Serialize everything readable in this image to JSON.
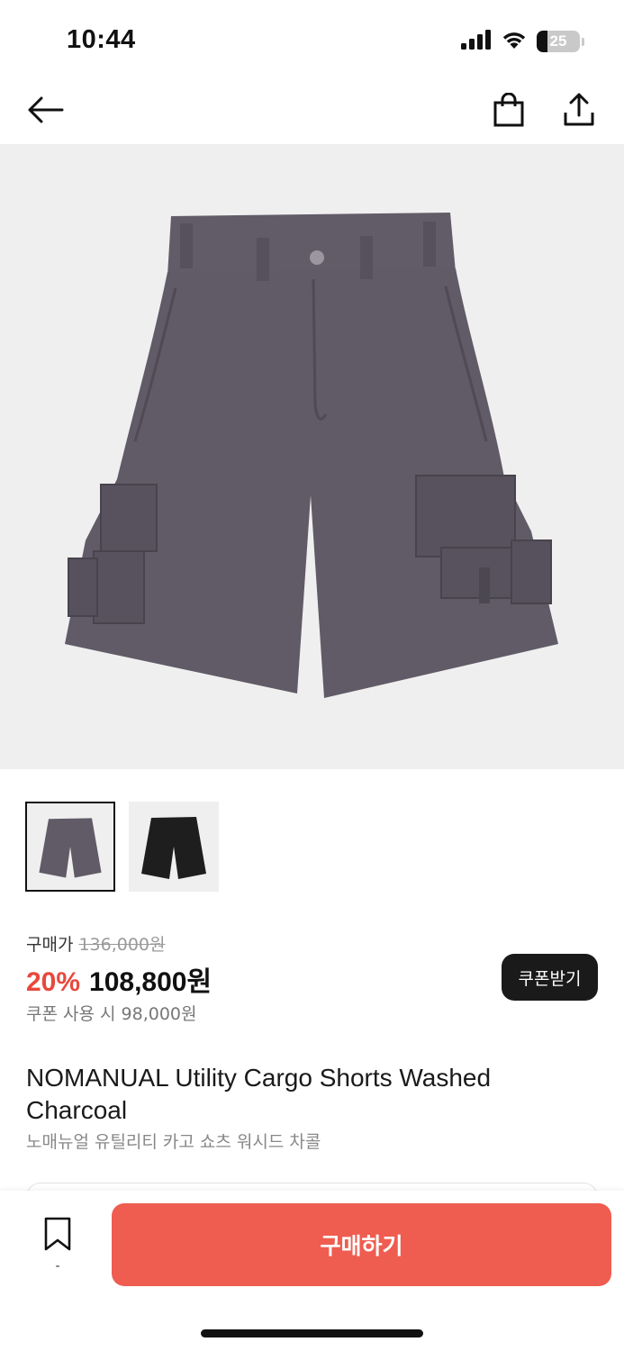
{
  "status_bar": {
    "time": "10:44",
    "battery_level": "25",
    "icons": [
      "signal-icon",
      "wifi-icon",
      "battery-icon"
    ]
  },
  "navbar": {
    "icons": [
      "back-arrow-icon",
      "shopping-bag-icon",
      "share-icon"
    ]
  },
  "product_image": {
    "color": "#605b66",
    "background": "#efefef"
  },
  "thumbnails": [
    {
      "color_name": "charcoal",
      "swatch": "#605b66",
      "selected": true
    },
    {
      "color_name": "black",
      "swatch": "#1e1e1e",
      "selected": false
    }
  ],
  "pricing": {
    "label": "구매가",
    "original_price": "136,000원",
    "discount_percent": "20%",
    "sale_price": "108,800원",
    "coupon_price": "쿠폰 사용 시 98,000원",
    "coupon_button_label": "쿠폰받기"
  },
  "product": {
    "title": "NOMANUAL Utility Cargo Shorts Washed Charcoal",
    "subtitle": "노매뉴얼 유틸리티 카고 쇼츠 워시드 차콜"
  },
  "bottom_bar": {
    "wish_count": "-",
    "buy_label": "구매하기"
  },
  "colors": {
    "accent": "#ee5d50",
    "discount": "#e8483c",
    "dark_button": "#1a1a1a"
  }
}
